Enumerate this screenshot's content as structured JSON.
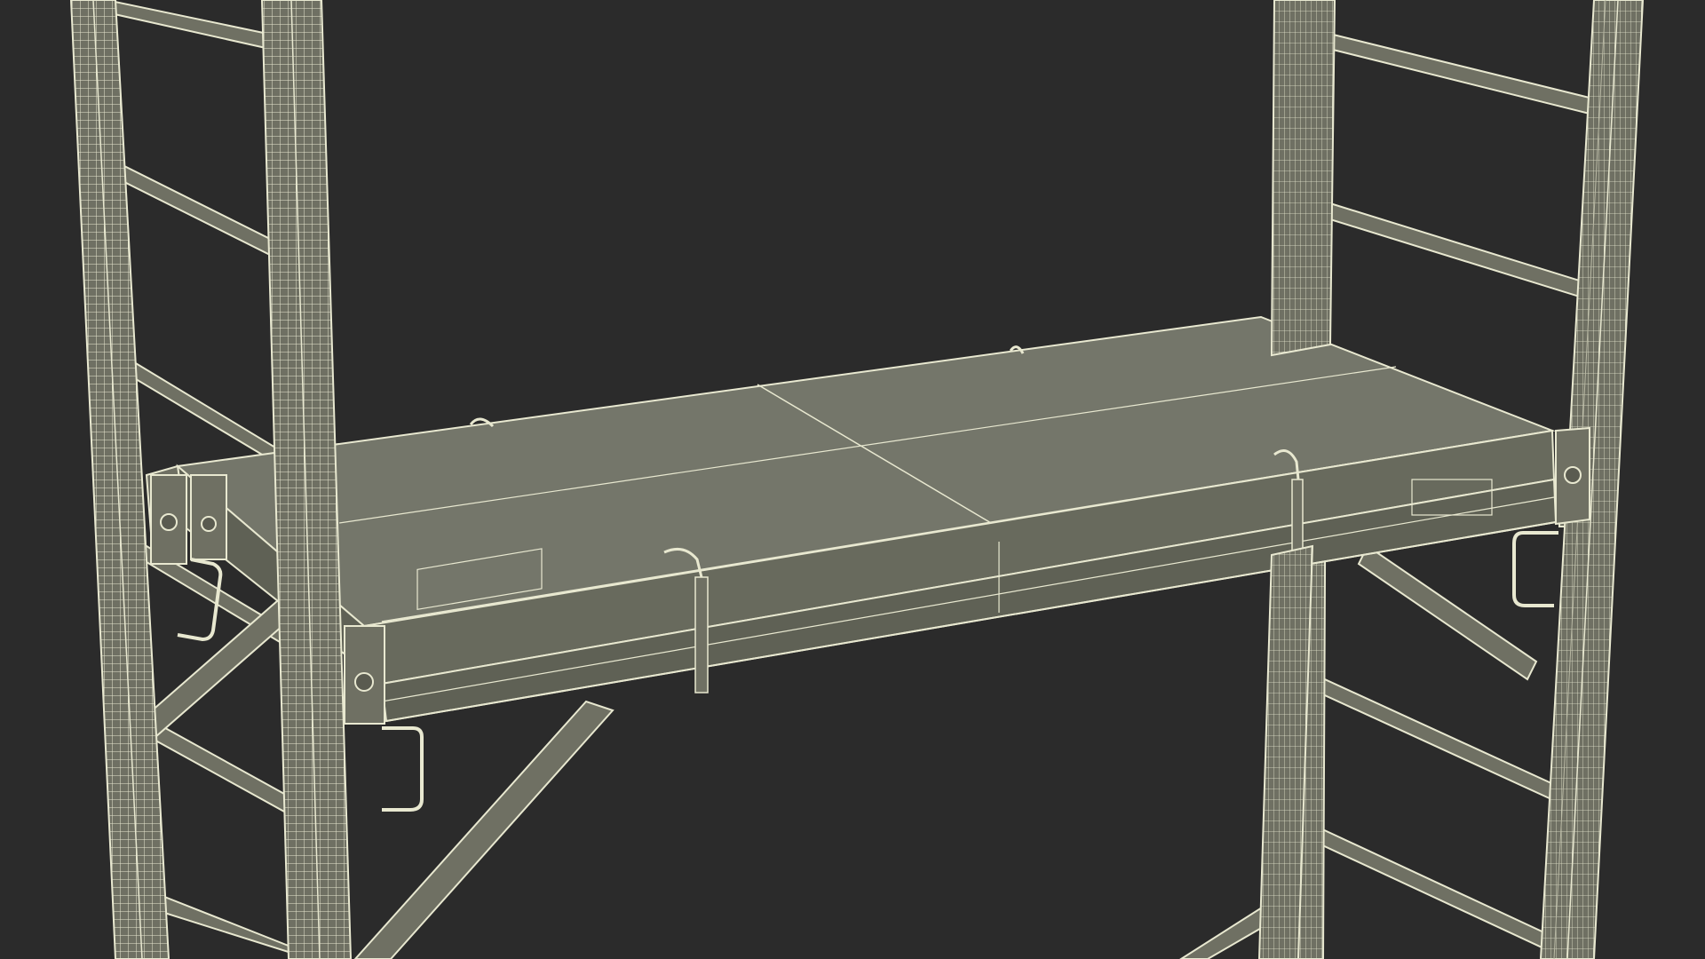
{
  "scene": {
    "subject": "scaffold-tower-wireframe",
    "colors": {
      "background": "#2b2b2b",
      "wire": "#e8e8d0",
      "wire_dim": "#b9b9a4",
      "metal": "#6f7063",
      "metal_dark": "#5a5b50",
      "deck": "#74766a",
      "deck_light": "#808276"
    }
  }
}
